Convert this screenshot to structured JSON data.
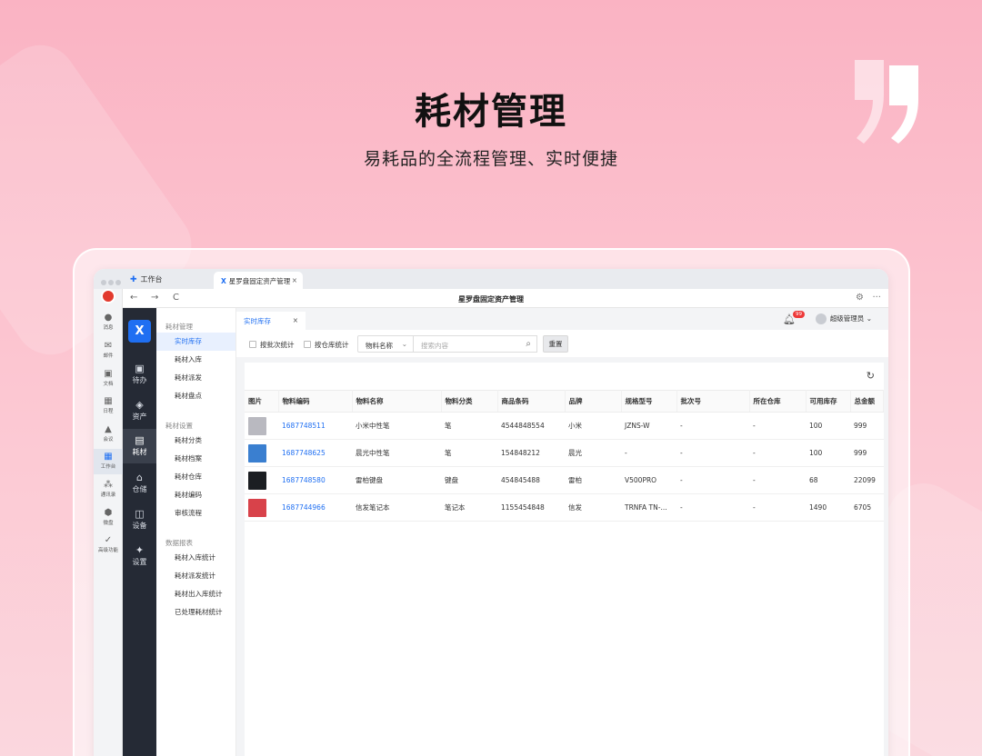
{
  "hero": {
    "title": "耗材管理",
    "subtitle": "易耗品的全流程管理、实时便捷"
  },
  "browser": {
    "tab_work": "工作台",
    "tab_active": "星罗盘固定资产管理",
    "tab_close": "×",
    "back": "←",
    "forward": "→",
    "reload": "C",
    "window_title": "星罗盘固定资产管理",
    "settings_icon": "⚙",
    "more": "···"
  },
  "rail": [
    {
      "label": "消息",
      "icon": "●"
    },
    {
      "label": "邮件",
      "icon": "✉"
    },
    {
      "label": "文档",
      "icon": "▣"
    },
    {
      "label": "日程",
      "icon": "▦"
    },
    {
      "label": "会议",
      "icon": "▲"
    },
    {
      "label": "工作台",
      "icon": "▦"
    },
    {
      "label": "通讯录",
      "icon": "⁂"
    },
    {
      "label": "微盘",
      "icon": "⬢"
    },
    {
      "label": "高级功能",
      "icon": "✓"
    }
  ],
  "sidebar": {
    "logo": "X",
    "items": [
      {
        "label": "待办",
        "icon": "▣"
      },
      {
        "label": "资产",
        "icon": "◈"
      },
      {
        "label": "耗材",
        "icon": "▤"
      },
      {
        "label": "仓储",
        "icon": "⌂"
      },
      {
        "label": "设备",
        "icon": "◫"
      },
      {
        "label": "设置",
        "icon": "✦"
      }
    ]
  },
  "menu": {
    "group1": "耗材管理",
    "group1_items": [
      "实时库存",
      "耗材入库",
      "耗材派发",
      "耗材盘点"
    ],
    "group2": "耗材设置",
    "group2_items": [
      "耗材分类",
      "耗材档案",
      "耗材仓库",
      "耗材编码",
      "审核流程"
    ],
    "group3": "数据报表",
    "group3_items": [
      "耗材入库统计",
      "耗材派发统计",
      "耗材出入库统计",
      "已处理耗材统计"
    ]
  },
  "content": {
    "tab_label": "实时库存",
    "tab_close": "×",
    "badge": "99",
    "user": "超级管理员",
    "user_chevron": "⌄"
  },
  "filter": {
    "by_batch": "按批次统计",
    "by_warehouse": "按仓库统计",
    "select_value": "物料名称",
    "select_chevron": "⌄",
    "search_placeholder": "搜索内容",
    "reset": "重置"
  },
  "table": {
    "columns": [
      "图片",
      "物料编码",
      "物料名称",
      "物料分类",
      "商品条码",
      "品牌",
      "规格型号",
      "批次号",
      "所在仓库",
      "可用库存",
      "总金额"
    ],
    "rows": [
      {
        "thumb": "#b9b9c0",
        "code": "1687748511",
        "name": "小米中性笔",
        "category": "笔",
        "barcode": "4544848554",
        "brand": "小米",
        "spec": "JZNS-W",
        "batch": "-",
        "warehouse": "-",
        "stock": "100",
        "amount": "999"
      },
      {
        "thumb": "#3a7fd0",
        "code": "1687748625",
        "name": "晨光中性笔",
        "category": "笔",
        "barcode": "154848212",
        "brand": "晨光",
        "spec": "-",
        "batch": "-",
        "warehouse": "-",
        "stock": "100",
        "amount": "999"
      },
      {
        "thumb": "#1b1e22",
        "code": "1687748580",
        "name": "雷柏键盘",
        "category": "键盘",
        "barcode": "454845488",
        "brand": "雷柏",
        "spec": "V500PRO",
        "batch": "-",
        "warehouse": "-",
        "stock": "68",
        "amount": "22099"
      },
      {
        "thumb": "#d8424a",
        "code": "1687744966",
        "name": "信发笔记本",
        "category": "笔记本",
        "barcode": "1155454848",
        "brand": "信发",
        "spec": "TRNFA TN-...",
        "batch": "-",
        "warehouse": "-",
        "stock": "1490",
        "amount": "6705"
      }
    ]
  }
}
